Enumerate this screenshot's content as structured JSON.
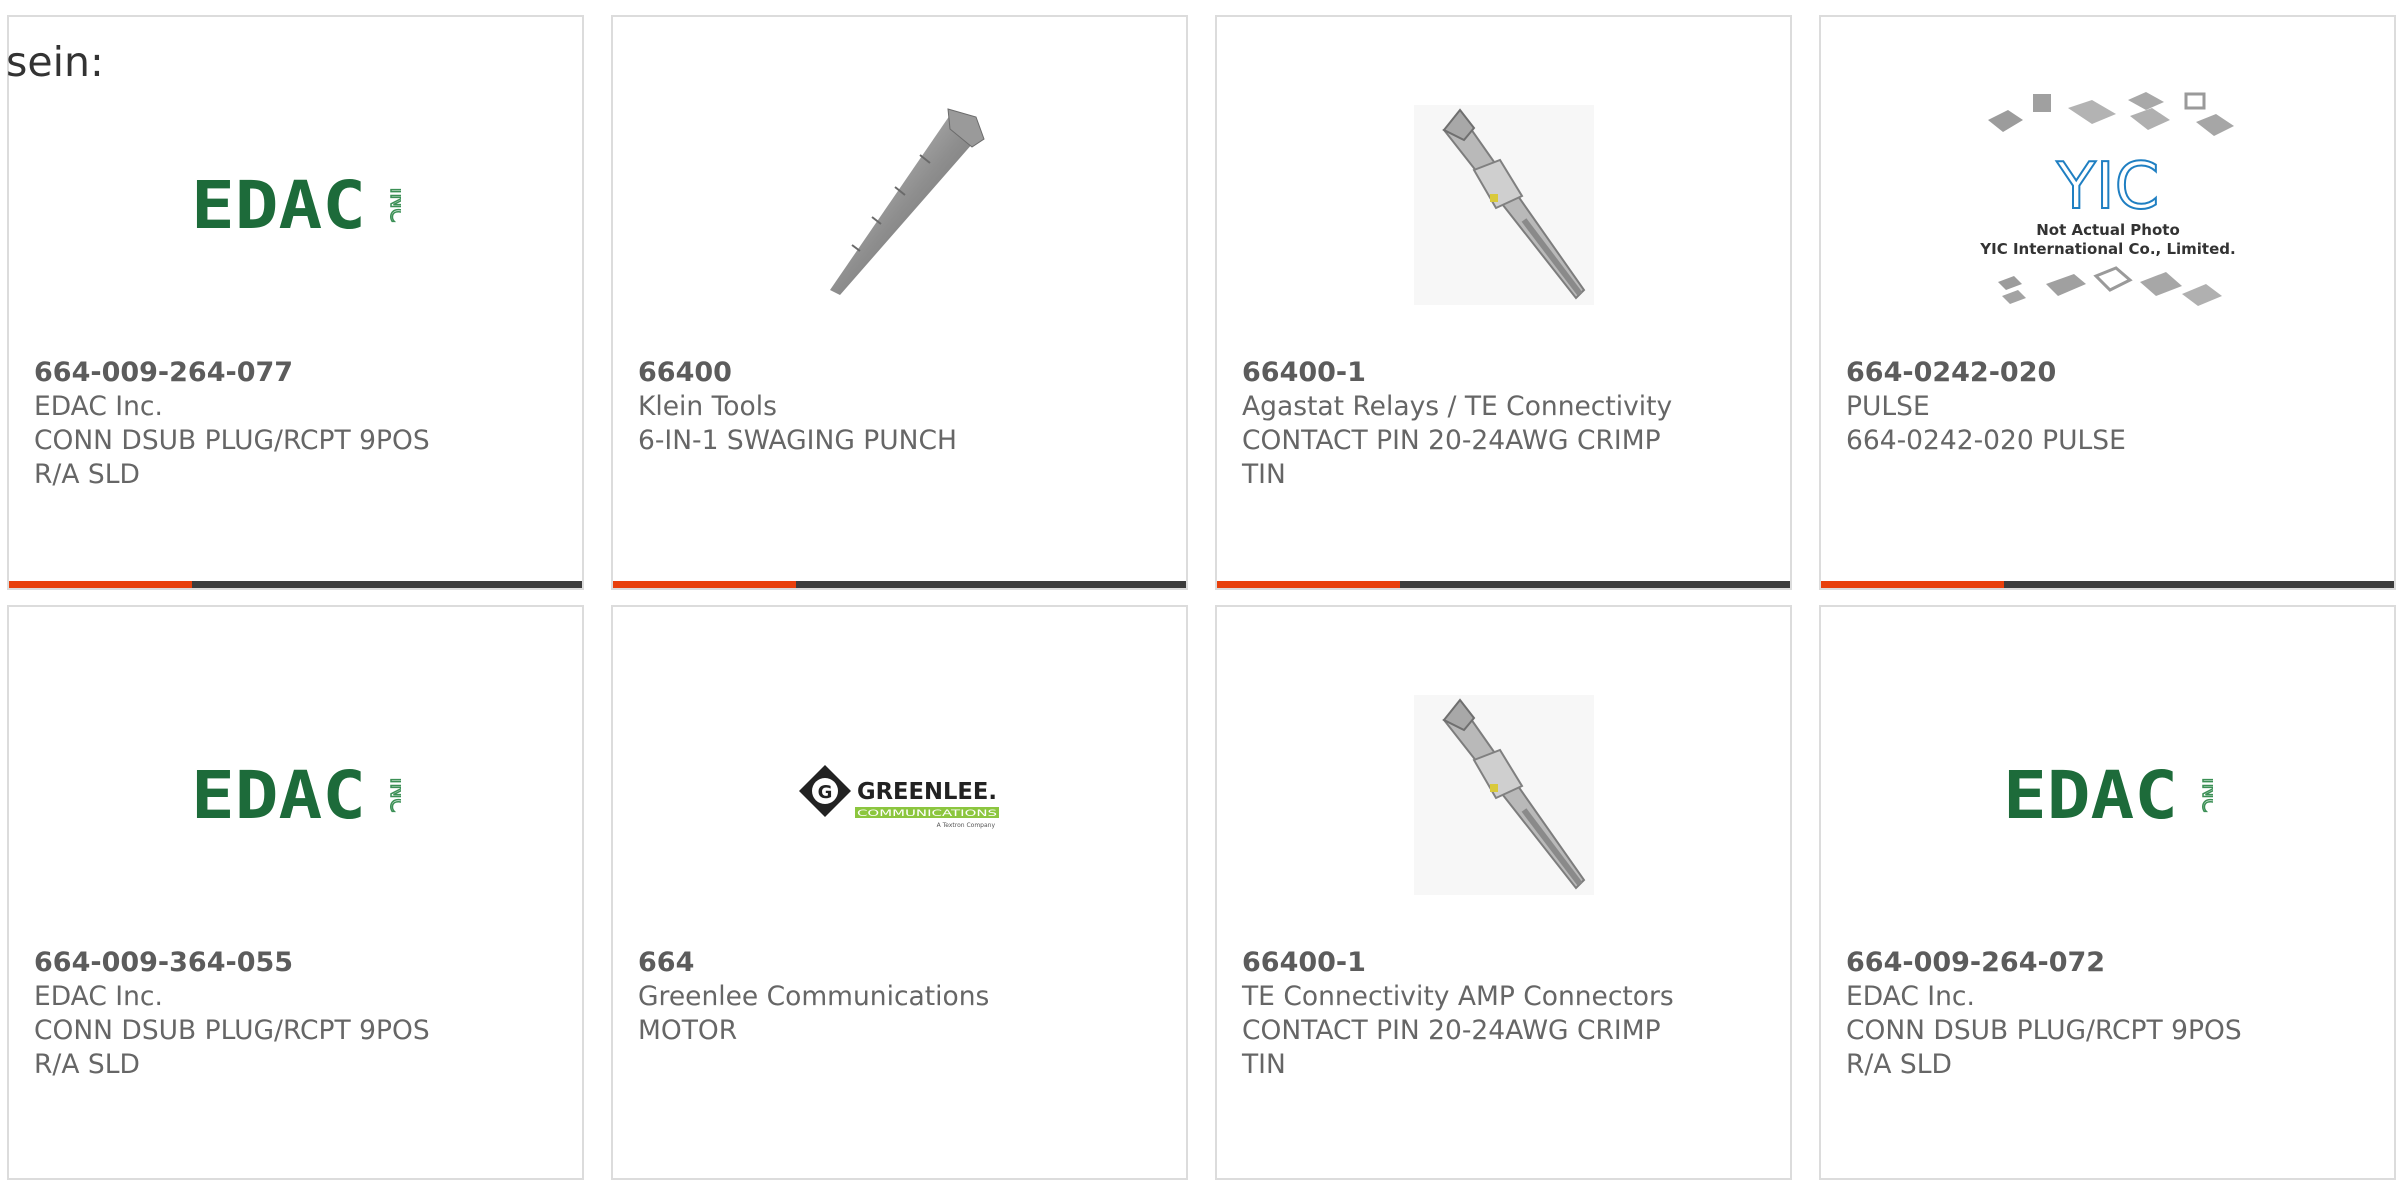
{
  "page": {
    "label": "sein:"
  },
  "products": [
    {
      "part": "664-009-264-077",
      "maker": "EDAC Inc.",
      "desc": [
        "CONN DSUB PLUG/RCPT 9POS",
        "R/A SLD"
      ],
      "image": "edac-logo"
    },
    {
      "part": "66400",
      "maker": "Klein Tools",
      "desc": [
        "6-IN-1 SWAGING PUNCH"
      ],
      "image": "swaging-punch-photo"
    },
    {
      "part": "66400-1",
      "maker": "Agastat Relays / TE Connectivity",
      "desc": [
        "CONTACT PIN 20-24AWG CRIMP",
        "TIN"
      ],
      "image": "contact-pin-photo"
    },
    {
      "part": "664-0242-020",
      "maker": "PULSE",
      "desc": [
        "664-0242-020 PULSE"
      ],
      "image": "yic-placeholder",
      "image_text": [
        "YIC",
        "Not Actual Photo",
        "YIC International Co., Limited."
      ]
    },
    {
      "part": "664-009-364-055",
      "maker": "EDAC Inc.",
      "desc": [
        "CONN DSUB PLUG/RCPT 9POS",
        "R/A SLD"
      ],
      "image": "edac-logo"
    },
    {
      "part": "664",
      "maker": "Greenlee Communications",
      "desc": [
        "MOTOR"
      ],
      "image": "greenlee-logo",
      "image_text": [
        "G",
        "GREENLEE.",
        "COMMUNICATIONS",
        "A Textron Company"
      ]
    },
    {
      "part": "66400-1",
      "maker": "TE Connectivity AMP Connectors",
      "desc": [
        "CONTACT PIN 20-24AWG CRIMP",
        "TIN"
      ],
      "image": "contact-pin-photo"
    },
    {
      "part": "664-009-264-072",
      "maker": "EDAC Inc.",
      "desc": [
        "CONN DSUB PLUG/RCPT 9POS",
        "R/A SLD"
      ],
      "image": "edac-logo"
    }
  ],
  "logo_text": {
    "edac_main": "EDAC",
    "edac_inc": "INC"
  },
  "colors": {
    "accent": "#e8400c",
    "bar": "#3c3c3c",
    "edac_green": "#1d6b3a",
    "greenlee_green": "#8cc63f"
  }
}
